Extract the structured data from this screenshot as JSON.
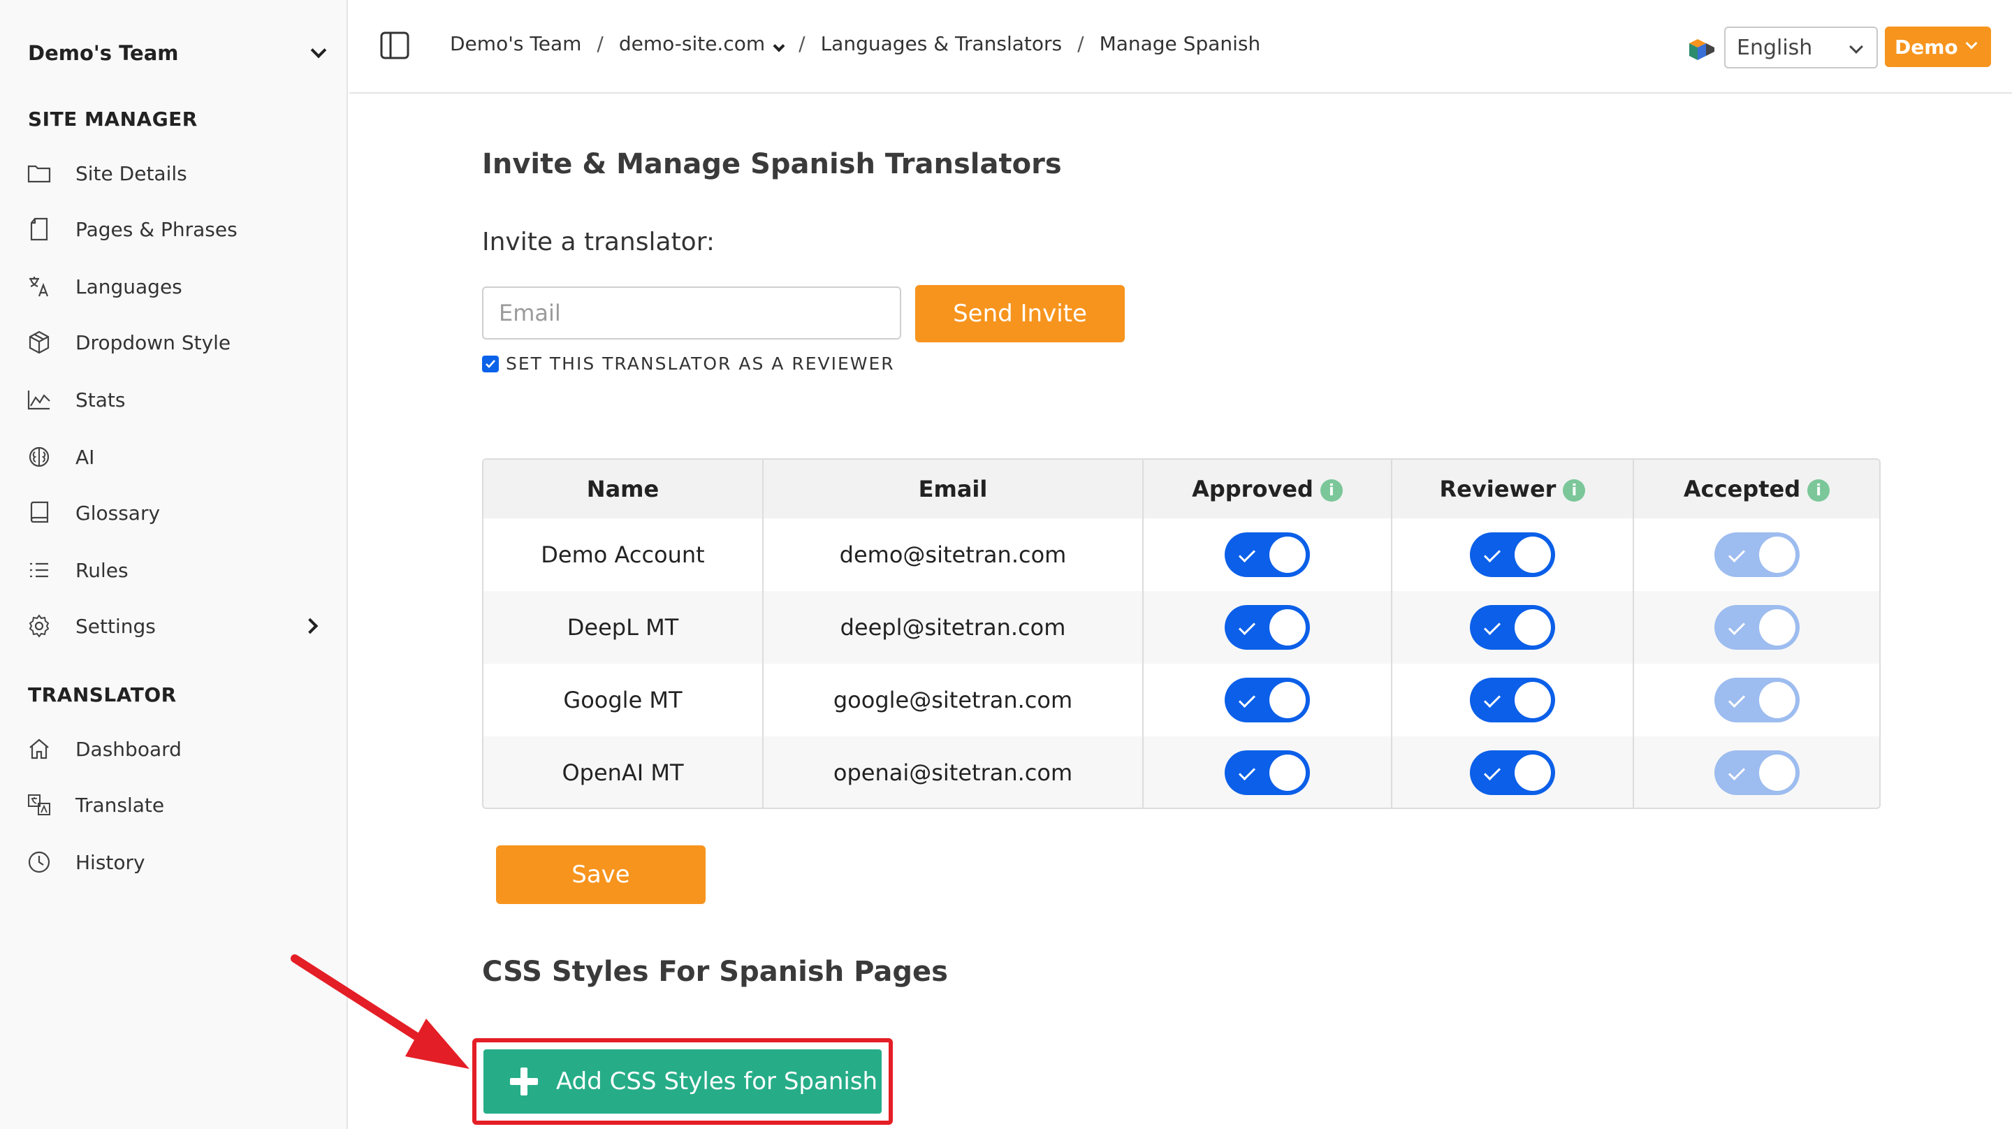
{
  "sidebar": {
    "team_name": "Demo's Team",
    "site_manager_title": "SITE MANAGER",
    "site_manager_items": [
      {
        "label": "Site Details",
        "icon": "folder-icon"
      },
      {
        "label": "Pages & Phrases",
        "icon": "page-icon"
      },
      {
        "label": "Languages",
        "icon": "translate-icon"
      },
      {
        "label": "Dropdown Style",
        "icon": "box-icon"
      },
      {
        "label": "Stats",
        "icon": "chart-icon"
      },
      {
        "label": "AI",
        "icon": "brain-icon"
      },
      {
        "label": "Glossary",
        "icon": "book-icon"
      },
      {
        "label": "Rules",
        "icon": "list-icon"
      },
      {
        "label": "Settings",
        "icon": "gear-icon"
      }
    ],
    "translator_title": "TRANSLATOR",
    "translator_items": [
      {
        "label": "Dashboard",
        "icon": "home-icon"
      },
      {
        "label": "Translate",
        "icon": "translate-doc-icon"
      },
      {
        "label": "History",
        "icon": "clock-icon"
      }
    ]
  },
  "topbar": {
    "breadcrumbs": [
      "Demo's Team",
      "demo-site.com",
      "Languages & Translators",
      "Manage Spanish"
    ],
    "language": "English",
    "user_button": "Demo"
  },
  "main": {
    "title": "Invite & Manage Spanish Translators",
    "invite_heading": "Invite a translator:",
    "email_placeholder": "Email",
    "send_invite_label": "Send Invite",
    "reviewer_checkbox_label": "SET THIS TRANSLATOR AS A REVIEWER",
    "reviewer_checked": true,
    "table": {
      "headers": [
        "Name",
        "Email",
        "Approved",
        "Reviewer",
        "Accepted"
      ],
      "rows": [
        {
          "name": "Demo Account",
          "email": "demo@sitetran.com",
          "approved": true,
          "reviewer": true,
          "accepted": true
        },
        {
          "name": "DeepL MT",
          "email": "deepl@sitetran.com",
          "approved": true,
          "reviewer": true,
          "accepted": true
        },
        {
          "name": "Google MT",
          "email": "google@sitetran.com",
          "approved": true,
          "reviewer": true,
          "accepted": true
        },
        {
          "name": "OpenAI MT",
          "email": "openai@sitetran.com",
          "approved": true,
          "reviewer": true,
          "accepted": true
        }
      ]
    },
    "save_label": "Save",
    "css_heading": "CSS Styles For Spanish Pages",
    "add_css_label": "Add CSS Styles for Spanish"
  },
  "colors": {
    "accent_orange": "#f7941d",
    "toggle_blue": "#0b5fe8",
    "toggle_disabled": "#9dbcef",
    "info_green": "#7bc79a",
    "add_css_green": "#26ad88",
    "highlight_red": "#e41e26"
  }
}
